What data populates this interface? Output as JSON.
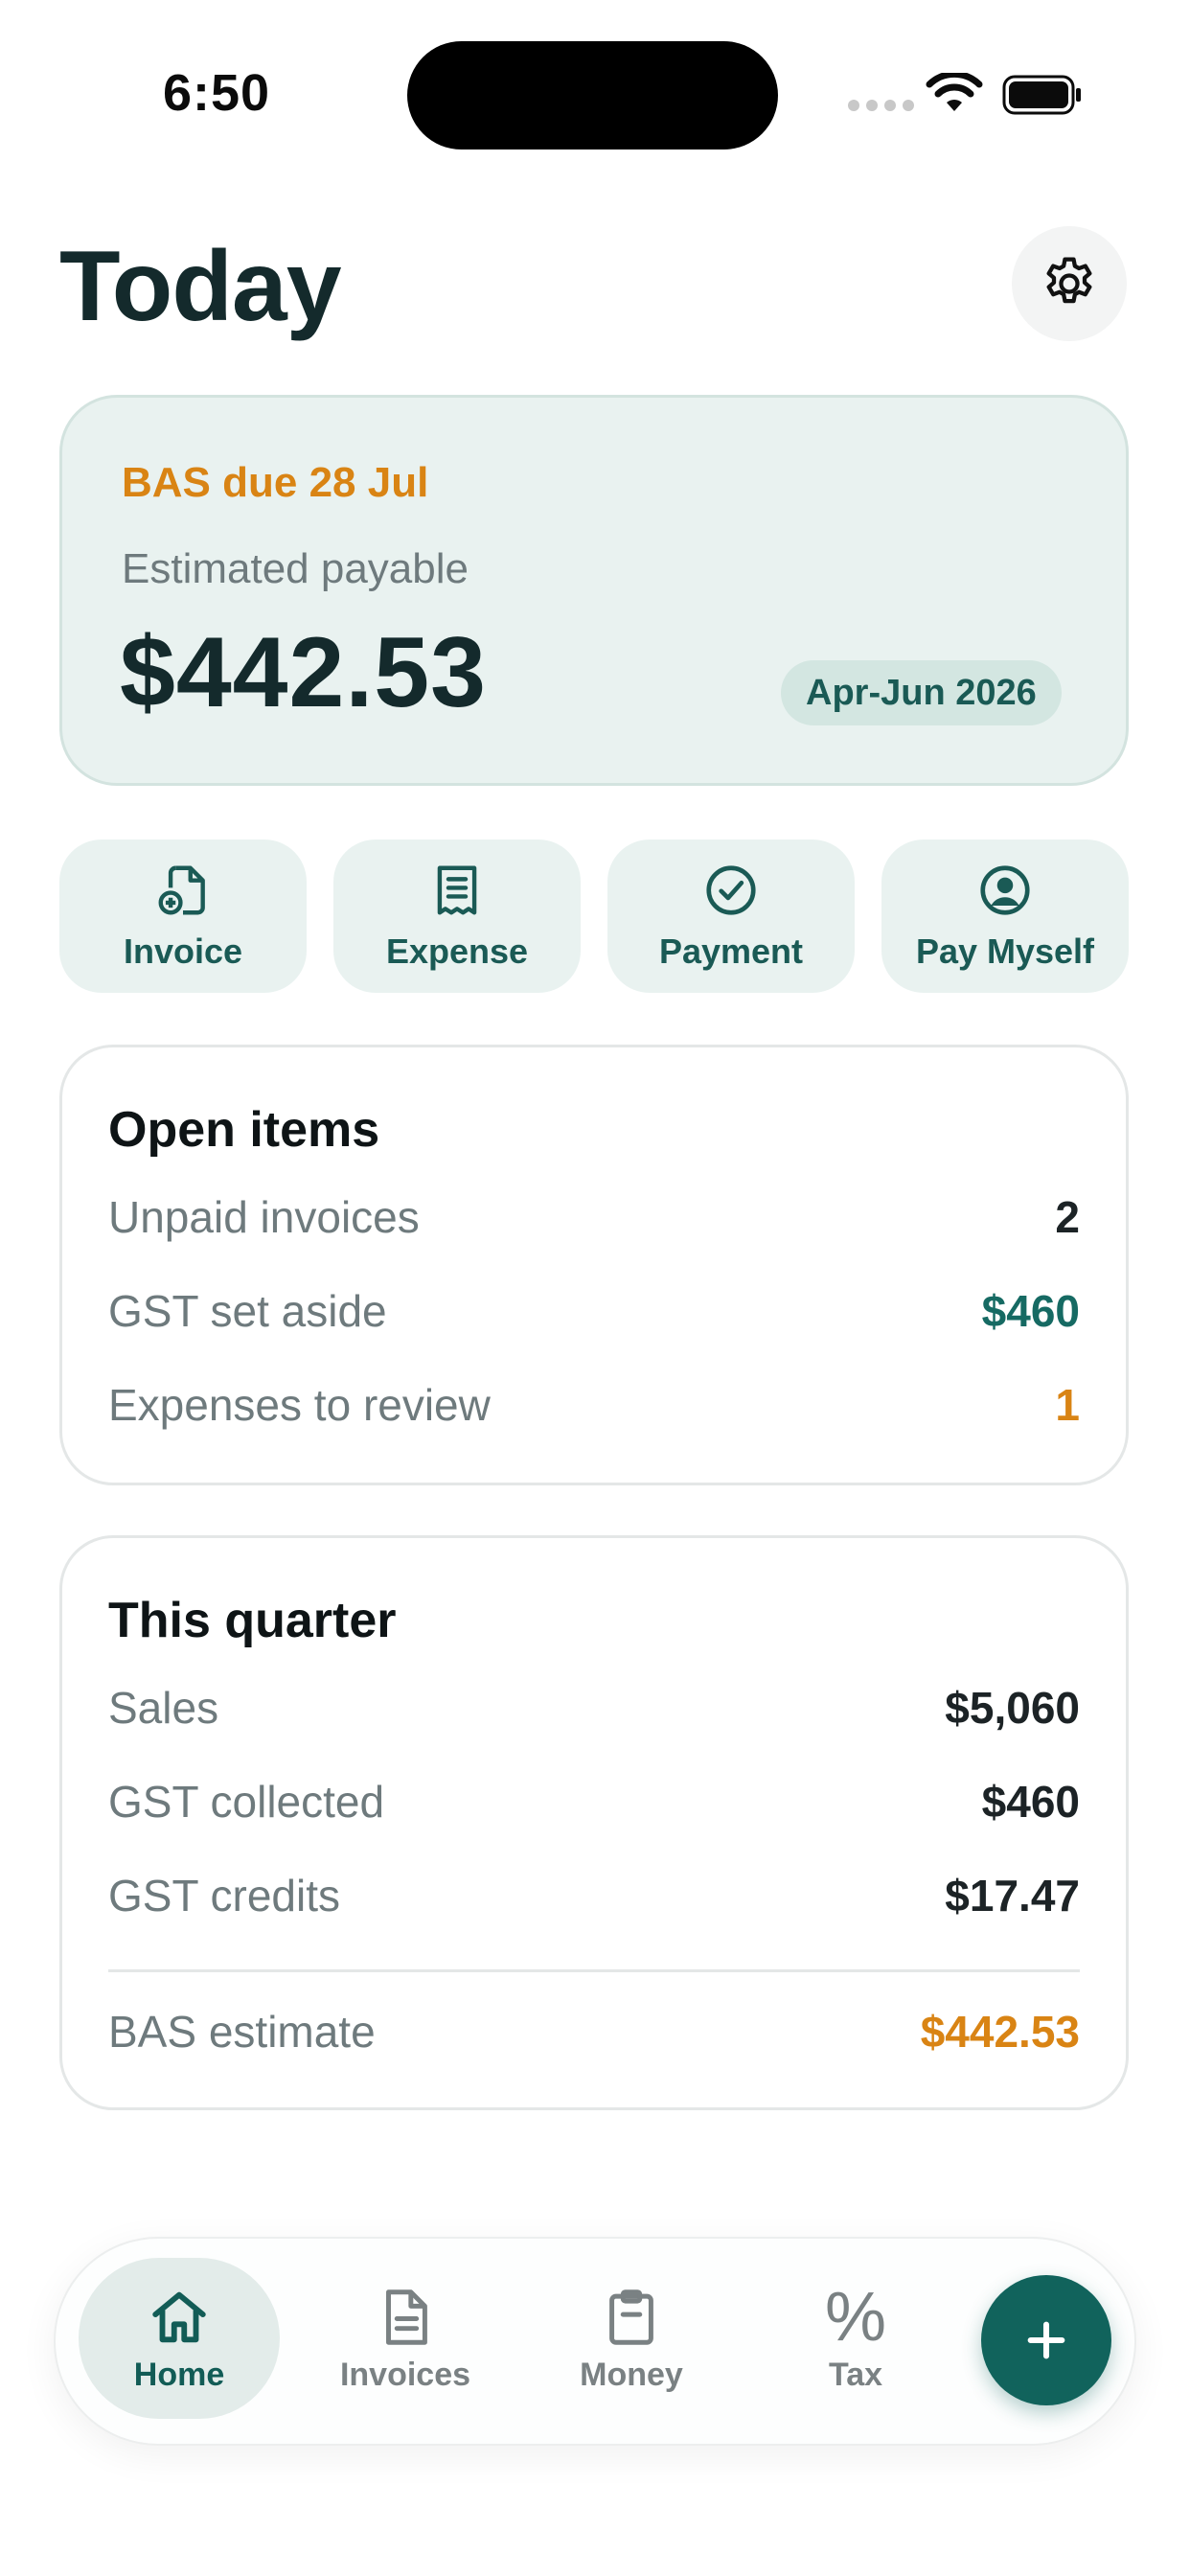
{
  "status_bar": {
    "time": "6:50"
  },
  "header": {
    "title": "Today"
  },
  "bas": {
    "due": "BAS due 28 Jul",
    "label": "Estimated payable",
    "amount": "$442.53",
    "period": "Apr-Jun 2026"
  },
  "actions": [
    {
      "label": "Invoice",
      "icon": "new-document-icon"
    },
    {
      "label": "Expense",
      "icon": "receipt-icon"
    },
    {
      "label": "Payment",
      "icon": "check-circle-icon"
    },
    {
      "label": "Pay Myself",
      "icon": "person-circle-icon"
    }
  ],
  "open_items": {
    "title": "Open items",
    "rows": [
      {
        "label": "Unpaid invoices",
        "value": "2"
      },
      {
        "label": "GST set aside",
        "value": "$460"
      },
      {
        "label": "Expenses to review",
        "value": "1"
      }
    ]
  },
  "quarter": {
    "title": "This quarter",
    "rows": [
      {
        "label": "Sales",
        "value": "$5,060"
      },
      {
        "label": "GST collected",
        "value": "$460"
      },
      {
        "label": "GST credits",
        "value": "$17.47"
      }
    ],
    "estimate_label": "BAS estimate",
    "estimate_value": "$442.53"
  },
  "tabs": [
    {
      "label": "Home",
      "icon": "home-icon",
      "active": true
    },
    {
      "label": "Invoices",
      "icon": "document-icon"
    },
    {
      "label": "Money",
      "icon": "clipboard-icon"
    },
    {
      "label": "Tax",
      "icon": "percent-icon",
      "glyph": "%"
    }
  ],
  "colors": {
    "brand_teal": "#11635c",
    "accent_orange": "#d98414",
    "card_tint": "#e9f2f0"
  }
}
